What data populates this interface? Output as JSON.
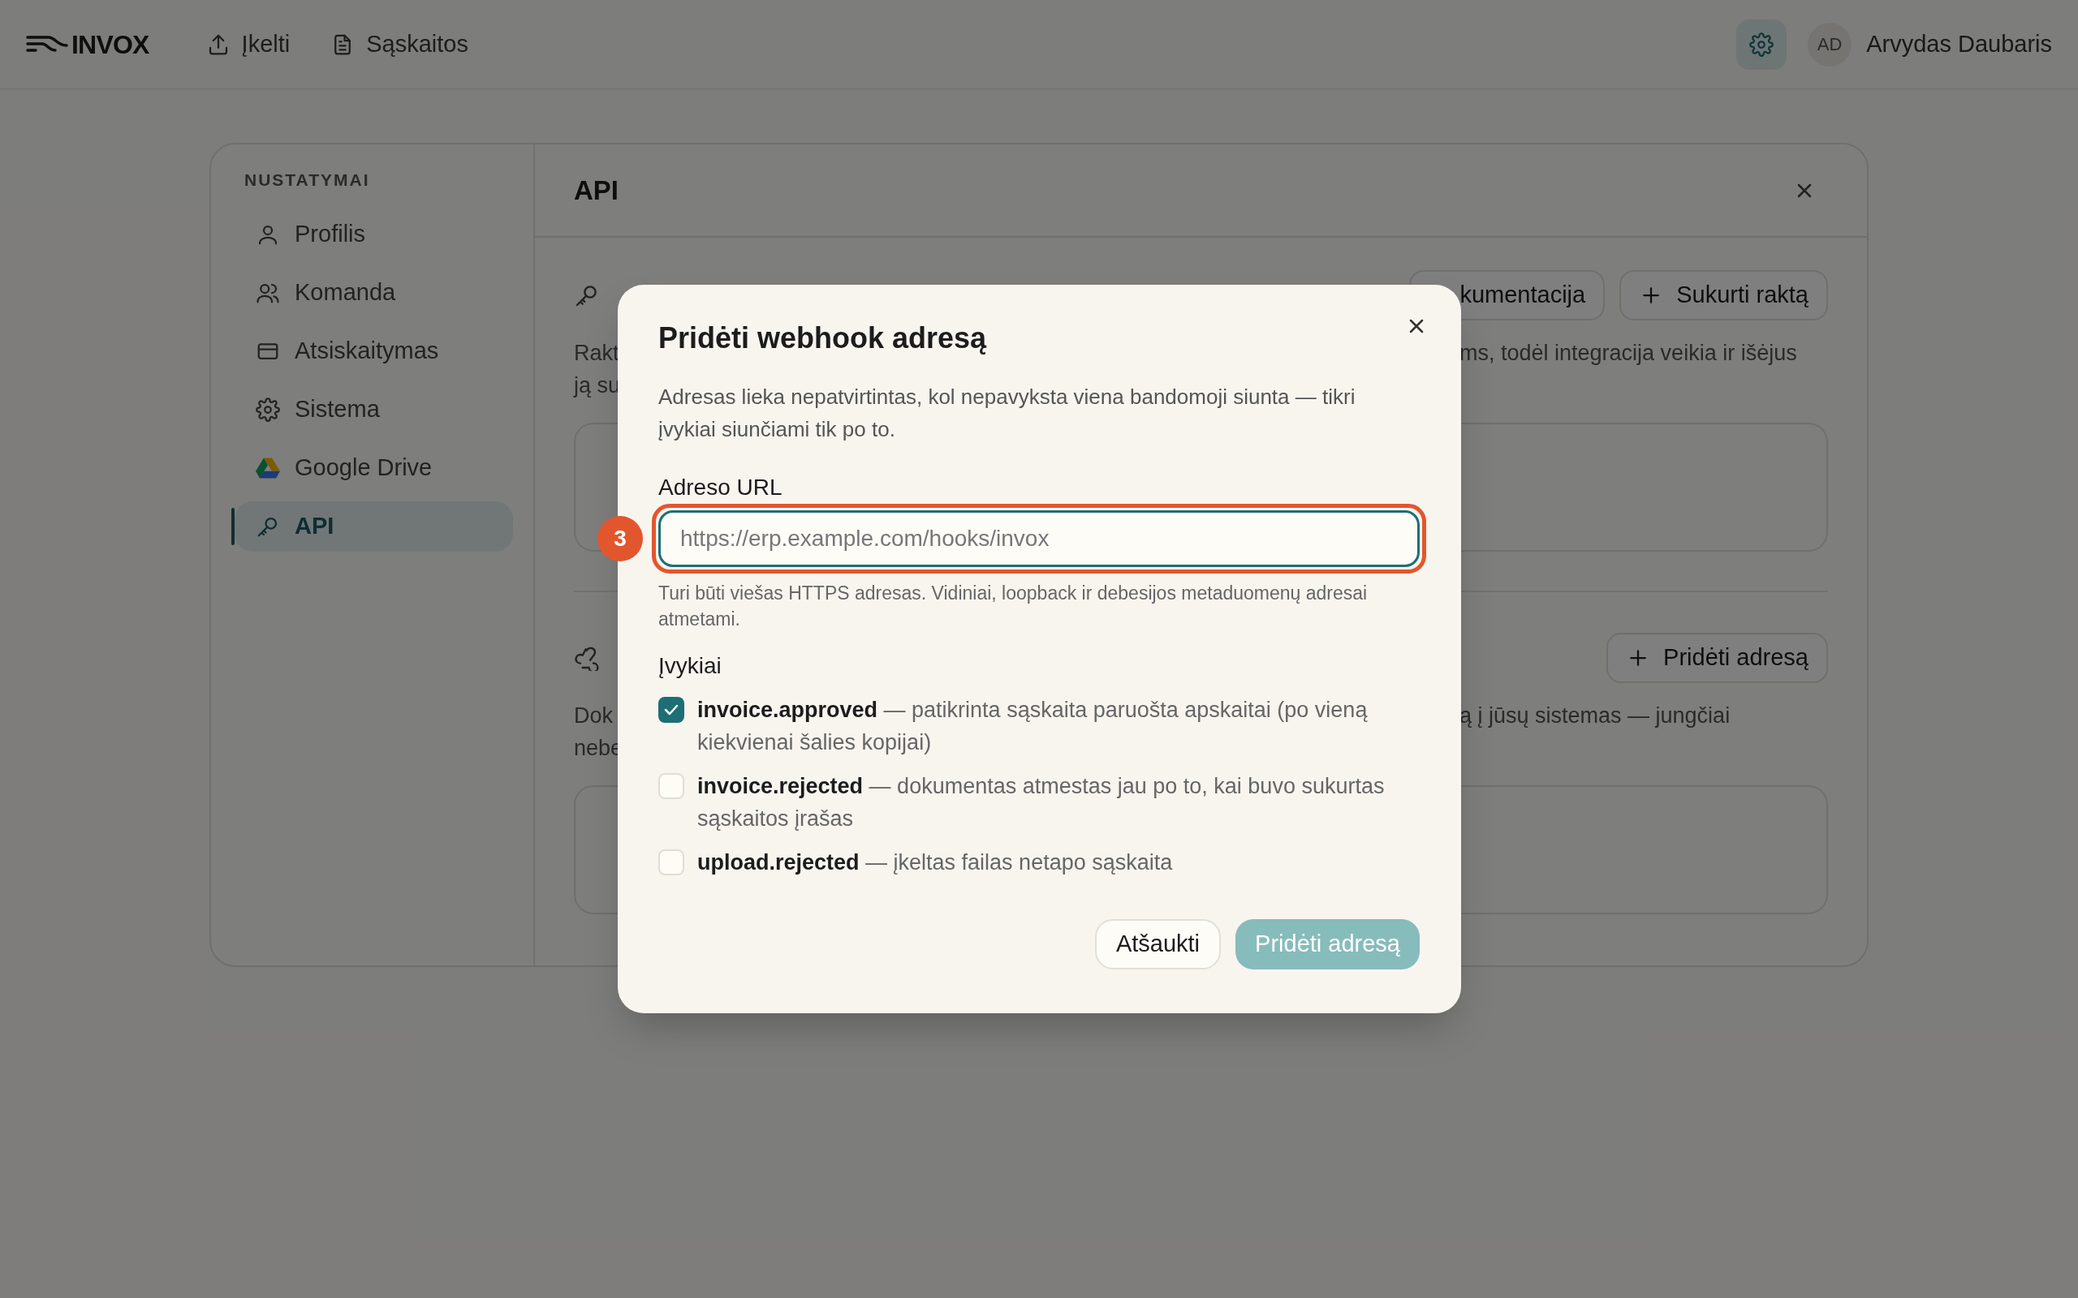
{
  "topbar": {
    "logo": "INVOX",
    "nav": [
      {
        "label": "Įkelti"
      },
      {
        "label": "Sąskaitos"
      }
    ],
    "user": {
      "initials": "AD",
      "name": "Arvydas Daubaris"
    }
  },
  "settings": {
    "sidebar": {
      "heading": "NUSTATYMAI",
      "items": [
        {
          "label": "Profilis",
          "selected": false
        },
        {
          "label": "Komanda",
          "selected": false
        },
        {
          "label": "Atsiskaitymas",
          "selected": false
        },
        {
          "label": "Sistema",
          "selected": false
        },
        {
          "label": "Google Drive",
          "selected": false
        },
        {
          "label": "API",
          "selected": true
        }
      ]
    },
    "panel_title": "API",
    "sections": [
      {
        "buttons": [
          {
            "label": "kumentacija",
            "kind": "plain"
          },
          {
            "label": "Sukurti raktą",
            "kind": "add"
          }
        ],
        "text_left": [
          "Rakt",
          "ją su"
        ],
        "text_right": "ms, todėl integracija veikia ir išėjus"
      },
      {
        "buttons": [
          {
            "label": "Pridėti adresą",
            "kind": "add"
          }
        ],
        "text_left": [
          "Dok",
          "nebe"
        ],
        "text_right": "ą į jūsų sistemas — jungčiai"
      }
    ]
  },
  "dialog": {
    "title": "Pridėti webhook adresą",
    "description": "Adresas lieka nepatvirtintas, kol nepavyksta viena bandomoji siunta — tikri įvykiai siunčiami tik po to.",
    "url_field": {
      "label": "Adreso URL",
      "placeholder": "https://erp.example.com/hooks/invox",
      "hint": "Turi būti viešas HTTPS adresas. Vidiniai, loopback ir debesijos metaduomenų adresai atmetami.",
      "annotation": "3"
    },
    "events_label": "Įvykiai",
    "events": [
      {
        "text": "**invoice.approved** — patikrinta sąskaita paruošta apskaitai (po vieną kiekvienai šalies kopijai)",
        "checked": true
      },
      {
        "text": "**invoice.rejected** — dokumentas atmestas jau po to, kai buvo sukurtas sąskaitos įrašas",
        "checked": false
      },
      {
        "text": "**upload.rejected** — įkeltas failas netapo sąskaita",
        "checked": false
      }
    ],
    "buttons": [
      {
        "label": "Atšaukti",
        "kind": "secondary"
      },
      {
        "label": "Pridėti adresą",
        "kind": "primary"
      }
    ]
  }
}
